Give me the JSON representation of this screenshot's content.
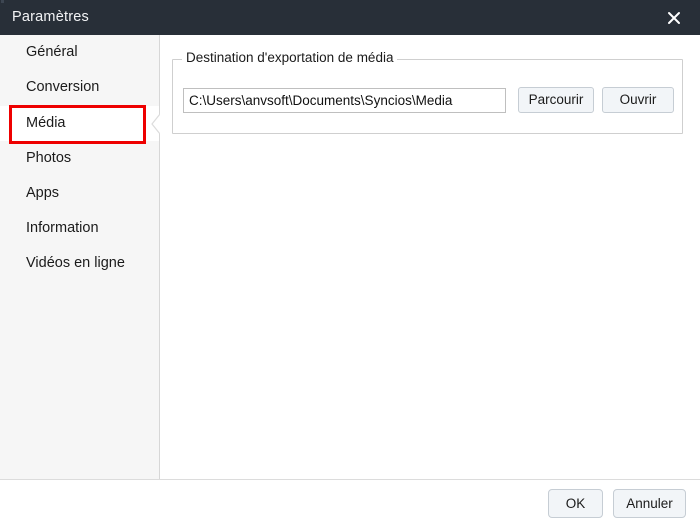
{
  "window": {
    "title": "Paramètres",
    "close_icon": "close-icon",
    "accent_highlight_color": "#ee0000",
    "titlebar_color": "#282f38"
  },
  "sidebar": {
    "items": [
      {
        "label": "Général",
        "selected": false
      },
      {
        "label": "Conversion",
        "selected": false
      },
      {
        "label": "Média",
        "selected": true
      },
      {
        "label": "Photos",
        "selected": false
      },
      {
        "label": "Apps",
        "selected": false
      },
      {
        "label": "Information",
        "selected": false
      },
      {
        "label": "Vidéos en ligne",
        "selected": false
      }
    ]
  },
  "main": {
    "group": {
      "legend": "Destination d'exportation de média",
      "path_field": {
        "value": "C:\\Users\\anvsoft\\Documents\\Syncios\\Media",
        "placeholder": "C:\\Users\\anvsoft\\Documents\\Syncios\\Media"
      },
      "browse_label": "Parcourir",
      "open_label": "Ouvrir"
    }
  },
  "footer": {
    "ok_label": "OK",
    "cancel_label": "Annuler"
  }
}
